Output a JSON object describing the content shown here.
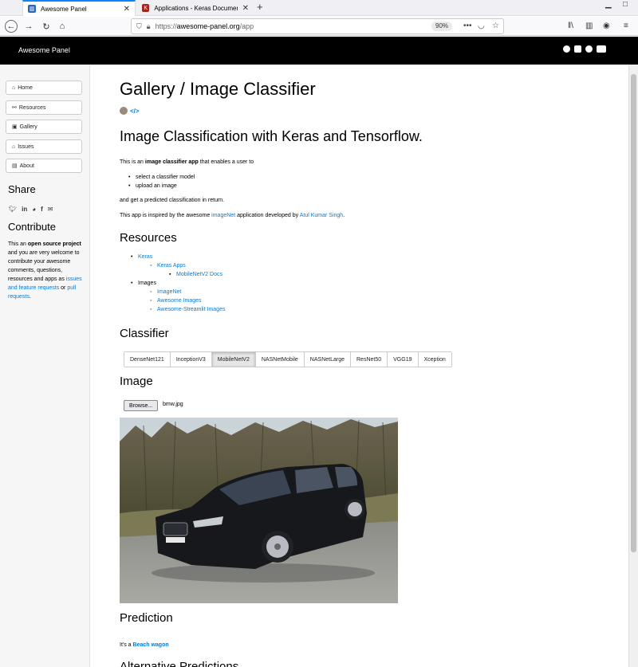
{
  "browser": {
    "tabs": [
      {
        "title": "Awesome Panel",
        "active": true
      },
      {
        "title": "Applications - Keras Documentati",
        "active": false
      }
    ],
    "url_scheme": "https://",
    "url_host": "awesome-panel.org",
    "url_path": "/app",
    "zoom": "90%"
  },
  "header": {
    "title": "Awesome Panel",
    "icons": [
      "github-icon",
      "book-icon",
      "code-icon",
      "docker-icon"
    ]
  },
  "sidebar": {
    "nav": [
      {
        "icon": "home-icon",
        "glyph": "⌂",
        "label": "Home"
      },
      {
        "icon": "link-icon",
        "glyph": "⚯",
        "label": "Resources"
      },
      {
        "icon": "images-icon",
        "glyph": "▣",
        "label": "Gallery"
      },
      {
        "icon": "bank-icon",
        "glyph": "⌂",
        "label": "Issues"
      },
      {
        "icon": "id-card-icon",
        "glyph": "▤",
        "label": "About"
      }
    ],
    "share_heading": "Share",
    "contribute_heading": "Contribute",
    "contribute": {
      "t1": "This an ",
      "b1": "open source project",
      "t2": " and you are very welcome to contribute your awesome comments, questions, resources and apps as ",
      "link1": "issues and feature requests",
      "t3": " or ",
      "link2": "pull requests",
      "t4": "."
    }
  },
  "main": {
    "page_title": "Gallery / Image Classifier",
    "app_heading": "Image Classification with Keras and Tensorflow.",
    "intro_a": "This is an ",
    "intro_b": "image classifier app",
    "intro_c": " that enables a user to",
    "bullets": [
      "select a classifier model",
      "upload an image"
    ],
    "after": "and get a predicted classification in return.",
    "inspired_a": "This app is inspired by the awesome ",
    "inspired_link1": "imageNet",
    "inspired_b": " application developed by ",
    "inspired_link2": "Atul Kumar Singh",
    "inspired_c": ".",
    "resources_heading": "Resources",
    "resources": {
      "keras": "Keras",
      "keras_apps": "Keras Apps",
      "mobilenet_docs": "MobileNetV2 Docs",
      "images": "Images",
      "imagenet": "ImageNet",
      "awesome_images": "Awesome Images",
      "awesome_streamlit": "Awesome-Streamlit Images"
    },
    "classifier_heading": "Classifier",
    "classifiers": [
      "DenseNet121",
      "InceptionV3",
      "MobileNetV2",
      "NASNetMobile",
      "NASNetLarge",
      "ResNet50",
      "VGG19",
      "Xception"
    ],
    "selected_classifier": "MobileNetV2",
    "image_heading": "Image",
    "browse_label": "Browse...",
    "file_name": "bmw.jpg",
    "prediction_heading": "Prediction",
    "prediction_prefix": "It's a ",
    "prediction_value": "Beach wagon",
    "alt_heading": "Alternative Predictions"
  }
}
